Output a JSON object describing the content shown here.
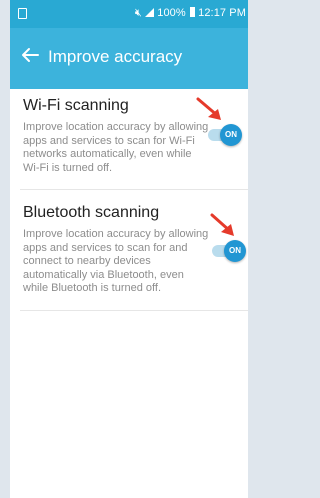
{
  "status_bar": {
    "battery_text": "100%",
    "time": "12:17 PM"
  },
  "app_bar": {
    "title": "Improve accuracy"
  },
  "settings": [
    {
      "title": "Wi-Fi scanning",
      "description": "Improve location accuracy by allowing apps and services to scan for Wi-Fi networks automatically, even while Wi-Fi is turned off.",
      "toggle_label": "ON"
    },
    {
      "title": "Bluetooth scanning",
      "description": "Improve location accuracy by allowing apps and services to scan for and connect to nearby devices automatically via Bluetooth, even while Bluetooth is turned off.",
      "toggle_label": "ON"
    }
  ],
  "colors": {
    "status_bar": "#29a9d3",
    "app_bar": "#3cb3dc",
    "toggle_on": "#2196d3",
    "arrow": "#e53a2b"
  }
}
